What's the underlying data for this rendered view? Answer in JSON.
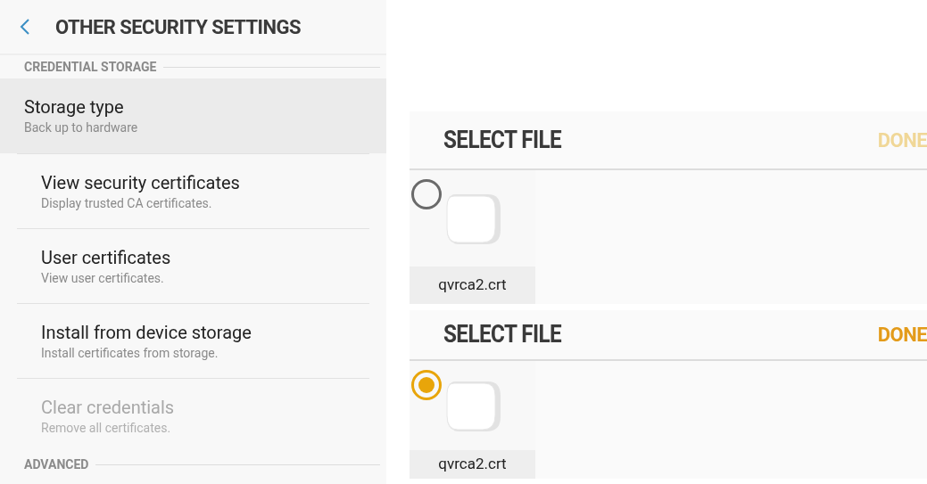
{
  "settings": {
    "title": "OTHER SECURITY SETTINGS",
    "sections": [
      {
        "header": "CREDENTIAL STORAGE",
        "items": [
          {
            "title": "Storage type",
            "subtitle": "Back up to hardware",
            "selected": true,
            "disabled": false
          },
          {
            "title": "View security certificates",
            "subtitle": "Display trusted CA certificates.",
            "selected": false,
            "disabled": false
          },
          {
            "title": "User certificates",
            "subtitle": "View user certificates.",
            "selected": false,
            "disabled": false
          },
          {
            "title": "Install from device storage",
            "subtitle": "Install certificates from storage.",
            "selected": false,
            "disabled": false
          },
          {
            "title": "Clear credentials",
            "subtitle": "Remove all certificates.",
            "selected": false,
            "disabled": true
          }
        ]
      },
      {
        "header": "ADVANCED"
      }
    ]
  },
  "file_pickers": [
    {
      "title": "SELECT FILE",
      "done": {
        "label": "DONE",
        "enabled": false
      },
      "files": [
        {
          "name": "qvrca2.crt",
          "selected": false
        }
      ]
    },
    {
      "title": "SELECT FILE",
      "done": {
        "label": "DONE",
        "enabled": true
      },
      "files": [
        {
          "name": "qvrca2.crt",
          "selected": true
        }
      ]
    }
  ]
}
